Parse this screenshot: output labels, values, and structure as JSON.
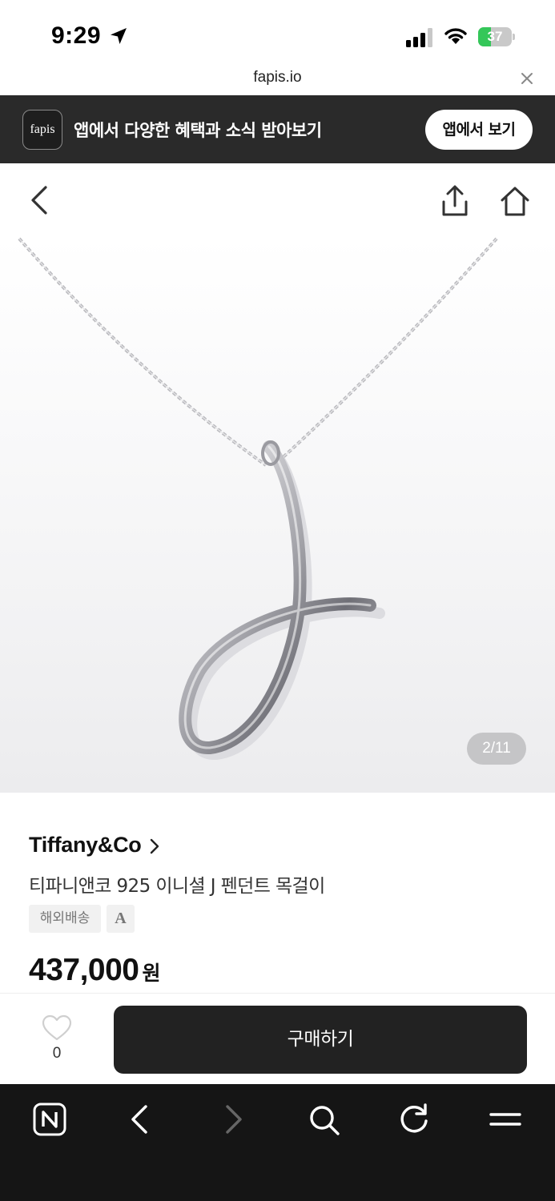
{
  "status_bar": {
    "time": "9:29",
    "battery_level": "37",
    "battery_fraction": 0.37,
    "battery_color": "#34c759",
    "icons": [
      "location-arrow-icon",
      "cellular-signal-icon",
      "wifi-icon",
      "battery-charging-icon"
    ]
  },
  "url_bar": {
    "domain": "fapis.io",
    "close_icon": "close-icon"
  },
  "app_banner": {
    "logo_text": "fapis",
    "message": "앱에서 다양한 혜택과 소식 받아보기",
    "button_label": "앱에서 보기"
  },
  "top_nav": {
    "icons": [
      "back-icon",
      "share-icon",
      "home-icon"
    ]
  },
  "product": {
    "image_counter": "2/11",
    "brand": "Tiffany&Co",
    "title": "티파니앤코 925 이니셜 J 펜던트 목걸이",
    "tags": [
      "해외배송",
      "A"
    ],
    "price": "437,000",
    "price_unit": "원"
  },
  "buy_bar": {
    "like_count": "0",
    "buy_label": "구매하기"
  },
  "browser_toolbar": {
    "items": [
      "naver-n-icon",
      "back-arrow-icon",
      "forward-arrow-icon",
      "search-icon",
      "reload-icon",
      "menu-icon"
    ]
  },
  "colors": {
    "banner_bg": "#2a2a2a",
    "buy_button": "#222222",
    "toolbar_bg": "#151515"
  }
}
